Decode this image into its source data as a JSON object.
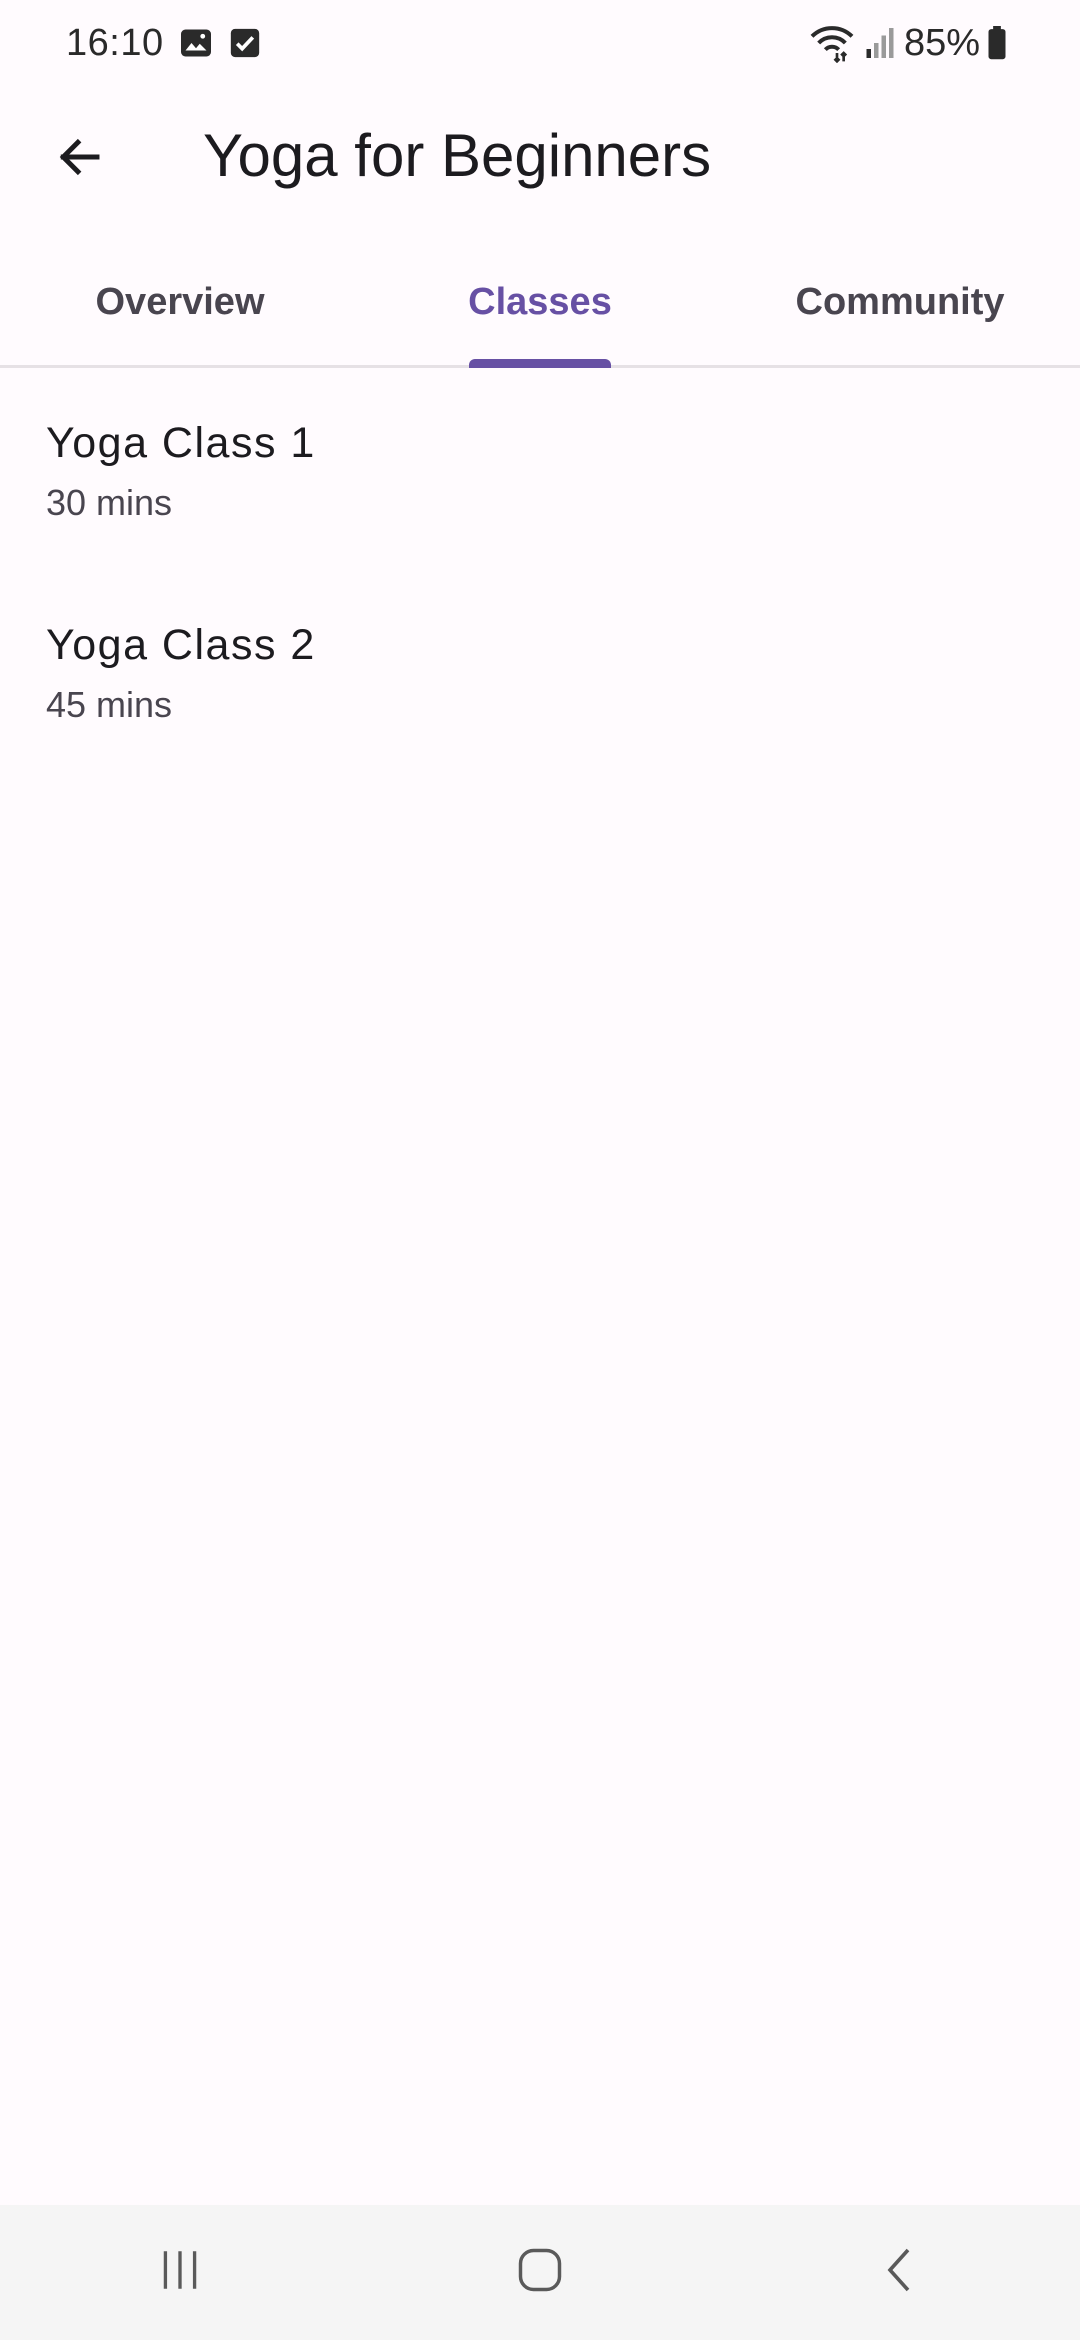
{
  "status_bar": {
    "time": "16:10",
    "battery": "85%",
    "icons": [
      "gallery-icon",
      "checkbox-icon",
      "wifi-icon",
      "signal-icon",
      "battery-icon"
    ]
  },
  "app_bar": {
    "title": "Yoga for Beginners",
    "back_icon": "arrow-back-icon"
  },
  "tabs": [
    {
      "label": "Overview",
      "active": false
    },
    {
      "label": "Classes",
      "active": true
    },
    {
      "label": "Community",
      "active": false
    }
  ],
  "classes": [
    {
      "name": "Yoga Class 1",
      "duration": "30 mins"
    },
    {
      "name": "Yoga Class 2",
      "duration": "45 mins"
    }
  ],
  "nav_bar": {
    "icons": [
      "recent-apps-icon",
      "home-icon",
      "back-icon"
    ]
  },
  "colors": {
    "accent": "#6750a4",
    "background": "#fffbfe",
    "nav_background": "#f5f5f5",
    "divider": "#e6e1e5"
  }
}
